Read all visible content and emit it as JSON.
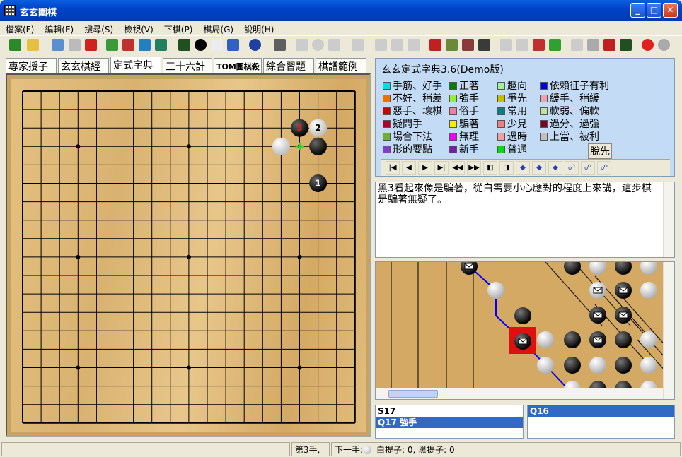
{
  "window": {
    "title": "玄玄圍棋"
  },
  "menu": [
    "檔案(F)",
    "編輯(E)",
    "搜尋(S)",
    "檢視(V)",
    "下棋(P)",
    "棋局(G)",
    "說明(H)"
  ],
  "tabs": [
    "專家授子",
    "玄玄棋經",
    "定式字典",
    "三十六計",
    "TOM圍棋殺",
    "綜合習題",
    "棋譜範例"
  ],
  "board": {
    "size": 19,
    "stones": [
      {
        "pt": "Q17",
        "color": "black",
        "label": "3"
      },
      {
        "pt": "R17",
        "color": "white",
        "label": "2"
      },
      {
        "pt": "P16",
        "color": "white",
        "label": ""
      },
      {
        "pt": "R16",
        "color": "black",
        "label": ""
      },
      {
        "pt": "R14",
        "color": "black",
        "label": "1"
      }
    ],
    "marker": "Q16"
  },
  "dict": {
    "title": "玄玄定式字典3.6(Demo版)",
    "legend": [
      {
        "label": "手筋、好手",
        "color": "#00e0e0"
      },
      {
        "label": "不好、稍差",
        "color": "#f07000"
      },
      {
        "label": "惡手、壞棋",
        "color": "#d00000"
      },
      {
        "label": "疑問手",
        "color": "#b00030"
      },
      {
        "label": "場合下法",
        "color": "#70b030"
      },
      {
        "label": "形的要點",
        "color": "#8040c0"
      },
      {
        "label": "正著",
        "color": "#008000"
      },
      {
        "label": "強手",
        "color": "#90f040"
      },
      {
        "label": "俗手",
        "color": "#f080a0"
      },
      {
        "label": "騙著",
        "color": "#f0f000"
      },
      {
        "label": "無理",
        "color": "#f000f0"
      },
      {
        "label": "新手",
        "color": "#7020a0"
      },
      {
        "label": "趣向",
        "color": "#a0f0a0"
      },
      {
        "label": "爭先",
        "color": "#c0c000"
      },
      {
        "label": "常用",
        "color": "#008080"
      },
      {
        "label": "少見",
        "color": "#f08080"
      },
      {
        "label": "過時",
        "color": "#f0a0a0"
      },
      {
        "label": "普通",
        "color": "#00e000"
      },
      {
        "label": "依賴征子有利",
        "color": "#0000e0"
      },
      {
        "label": "緩手、稍緩",
        "color": "#f0a0b0"
      },
      {
        "label": "軟弱、偏軟",
        "color": "#c0e0a0"
      },
      {
        "label": "過分、過強",
        "color": "#800020"
      },
      {
        "label": "上當、被利",
        "color": "#c0c0c0"
      }
    ],
    "tuoxian": "脫先"
  },
  "comment": "黑3看起來像是騙著，從白需要小心應對的程度上來講，這步棋是騙著無疑了。",
  "listLeft": [
    {
      "text": "S17",
      "sel": false
    },
    {
      "text": "Q17  強手",
      "sel": true
    }
  ],
  "listRight": [
    {
      "text": "Q16",
      "sel": true
    }
  ],
  "status": {
    "move": "第3手,",
    "next": "下一手:",
    "captures": "白提子: 0, 黑提子: 0"
  }
}
